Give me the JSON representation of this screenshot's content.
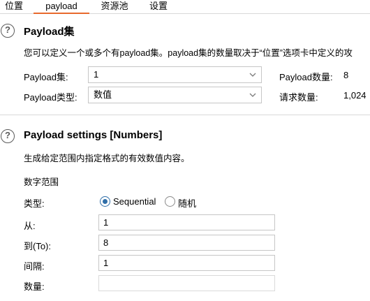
{
  "tabs": [
    {
      "label": "位置",
      "active": false
    },
    {
      "label": "payload",
      "active": true
    },
    {
      "label": "资源池",
      "active": false
    },
    {
      "label": "设置",
      "active": false
    }
  ],
  "accent_color": "#e8692d",
  "radio_color": "#2f6ea8",
  "payload_sets": {
    "title": "Payload集",
    "description": "您可以定义一个或多个有payload集。payload集的数量取决于“位置”选项卡中定义的攻",
    "set_label": "Payload集:",
    "set_value": "1",
    "type_label": "Payload类型:",
    "type_value": "数值",
    "count_label": "Payload数量:",
    "count_value": "8",
    "requests_label": "请求数量:",
    "requests_value": "1,024"
  },
  "payload_settings": {
    "title": "Payload settings [Numbers]",
    "description": "生成给定范围内指定格式的有效数值内容。",
    "range_heading": "数字范围",
    "type_label": "类型:",
    "sequential_label": "Sequential",
    "random_label": "随机",
    "selected": "Sequential",
    "from_label": "从:",
    "from_value": "1",
    "to_label": "到(To):",
    "to_value": "8",
    "step_label": "间隔:",
    "step_value": "1",
    "count_label": "数量:",
    "count_value": ""
  }
}
